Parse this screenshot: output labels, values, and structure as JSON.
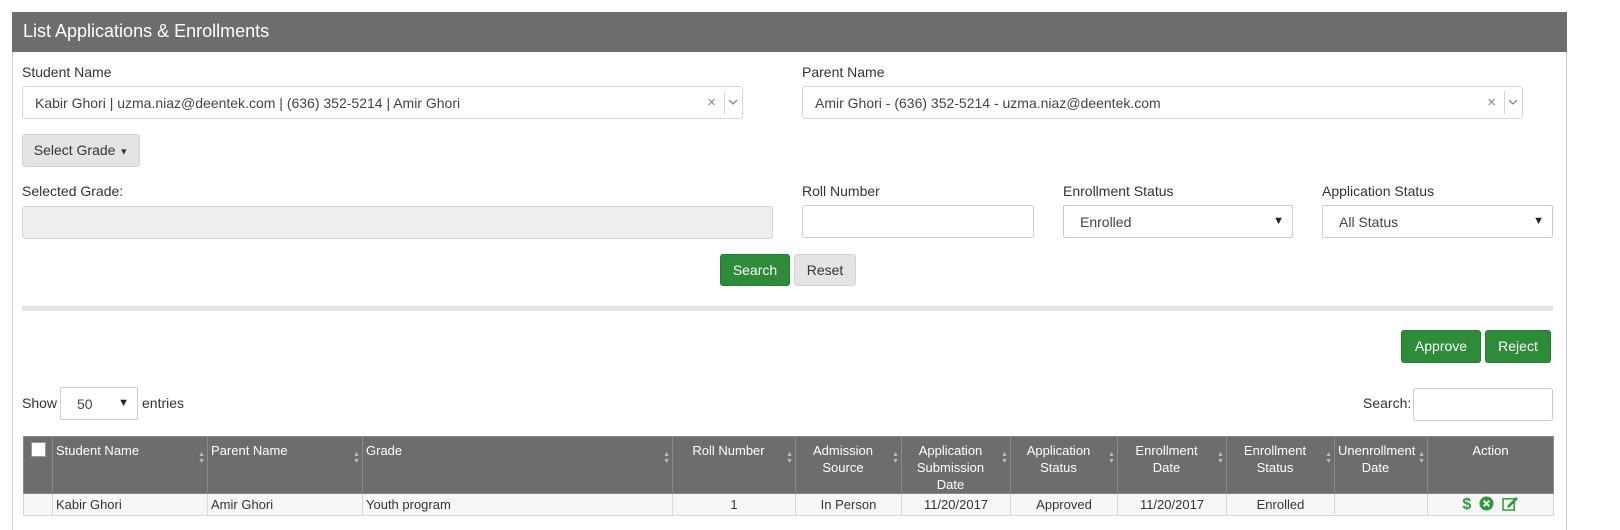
{
  "panel": {
    "title": "List Applications & Enrollments"
  },
  "filters": {
    "student_name": {
      "label": "Student Name",
      "value": "Kabir Ghori | uzma.niaz@deentek.com | (636) 352-5214 | Amir Ghori",
      "clear": "×"
    },
    "parent_name": {
      "label": "Parent Name",
      "value": "Amir Ghori - (636) 352-5214 - uzma.niaz@deentek.com",
      "clear": "×"
    },
    "select_grade": {
      "label": "Select Grade"
    },
    "selected_grade": {
      "label": "Selected Grade:",
      "value": ""
    },
    "roll_number": {
      "label": "Roll Number",
      "value": ""
    },
    "enrollment_status": {
      "label": "Enrollment Status",
      "value": "Enrolled"
    },
    "application_status": {
      "label": "Application Status",
      "value": "All Status"
    },
    "search_label": "Search",
    "reset_label": "Reset"
  },
  "actions": {
    "approve_label": "Approve",
    "reject_label": "Reject"
  },
  "table_controls": {
    "show_label": "Show",
    "entries_value": "50",
    "entries_label": "entries",
    "search_label": "Search:",
    "search_value": ""
  },
  "table": {
    "columns": [
      "Student Name",
      "Parent Name",
      "Grade",
      "Roll Number",
      "Admission Source",
      "Application Submission Date",
      "Application Status",
      "Enrollment Date",
      "Enrollment Status",
      "Unenrollment Date",
      "Action"
    ],
    "rows": [
      {
        "student_name": "Kabir Ghori",
        "parent_name": "Amir Ghori",
        "grade": "Youth program",
        "roll_number": "1",
        "admission_source": "In Person",
        "submission_date": "11/20/2017",
        "application_status": "Approved",
        "enrollment_date": "11/20/2017",
        "enrollment_status": "Enrolled",
        "unenrollment_date": ""
      }
    ]
  },
  "colors": {
    "header_bg": "#6d6d6d",
    "accent_green": "#2e8b3a"
  }
}
